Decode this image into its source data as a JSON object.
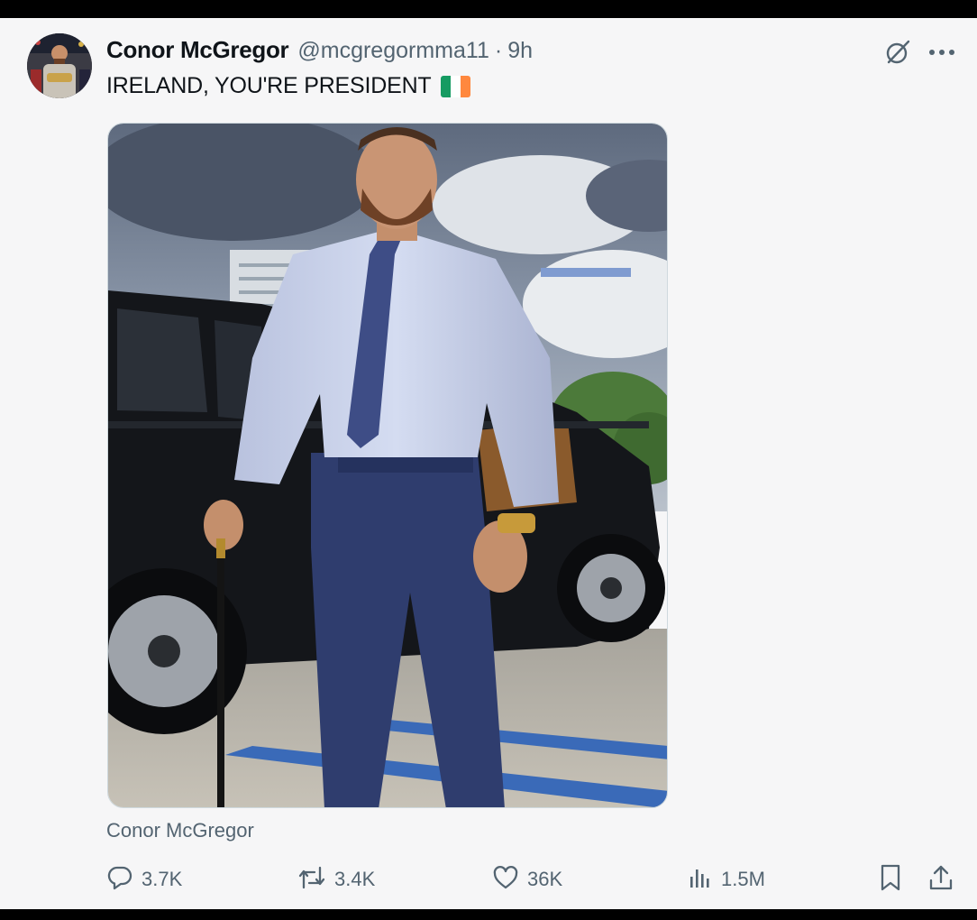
{
  "post": {
    "author_name": "Conor McGregor",
    "handle": "@mcgregormma11",
    "separator": "·",
    "timestamp": "9h",
    "text": "IRELAND, YOU'RE PRESIDENT",
    "flag_colors": [
      "#169b62",
      "#ffffff",
      "#ff883e"
    ],
    "media_caption": "Conor McGregor"
  },
  "actions": {
    "replies": "3.7K",
    "reposts": "3.4K",
    "likes": "36K",
    "views": "1.5M"
  },
  "colors": {
    "text_primary": "#0f1419",
    "text_secondary": "#536471",
    "background": "#f6f6f7"
  },
  "icons": [
    "grok-icon",
    "more-icon",
    "reply-icon",
    "repost-icon",
    "like-icon",
    "views-icon",
    "bookmark-icon",
    "share-icon"
  ]
}
